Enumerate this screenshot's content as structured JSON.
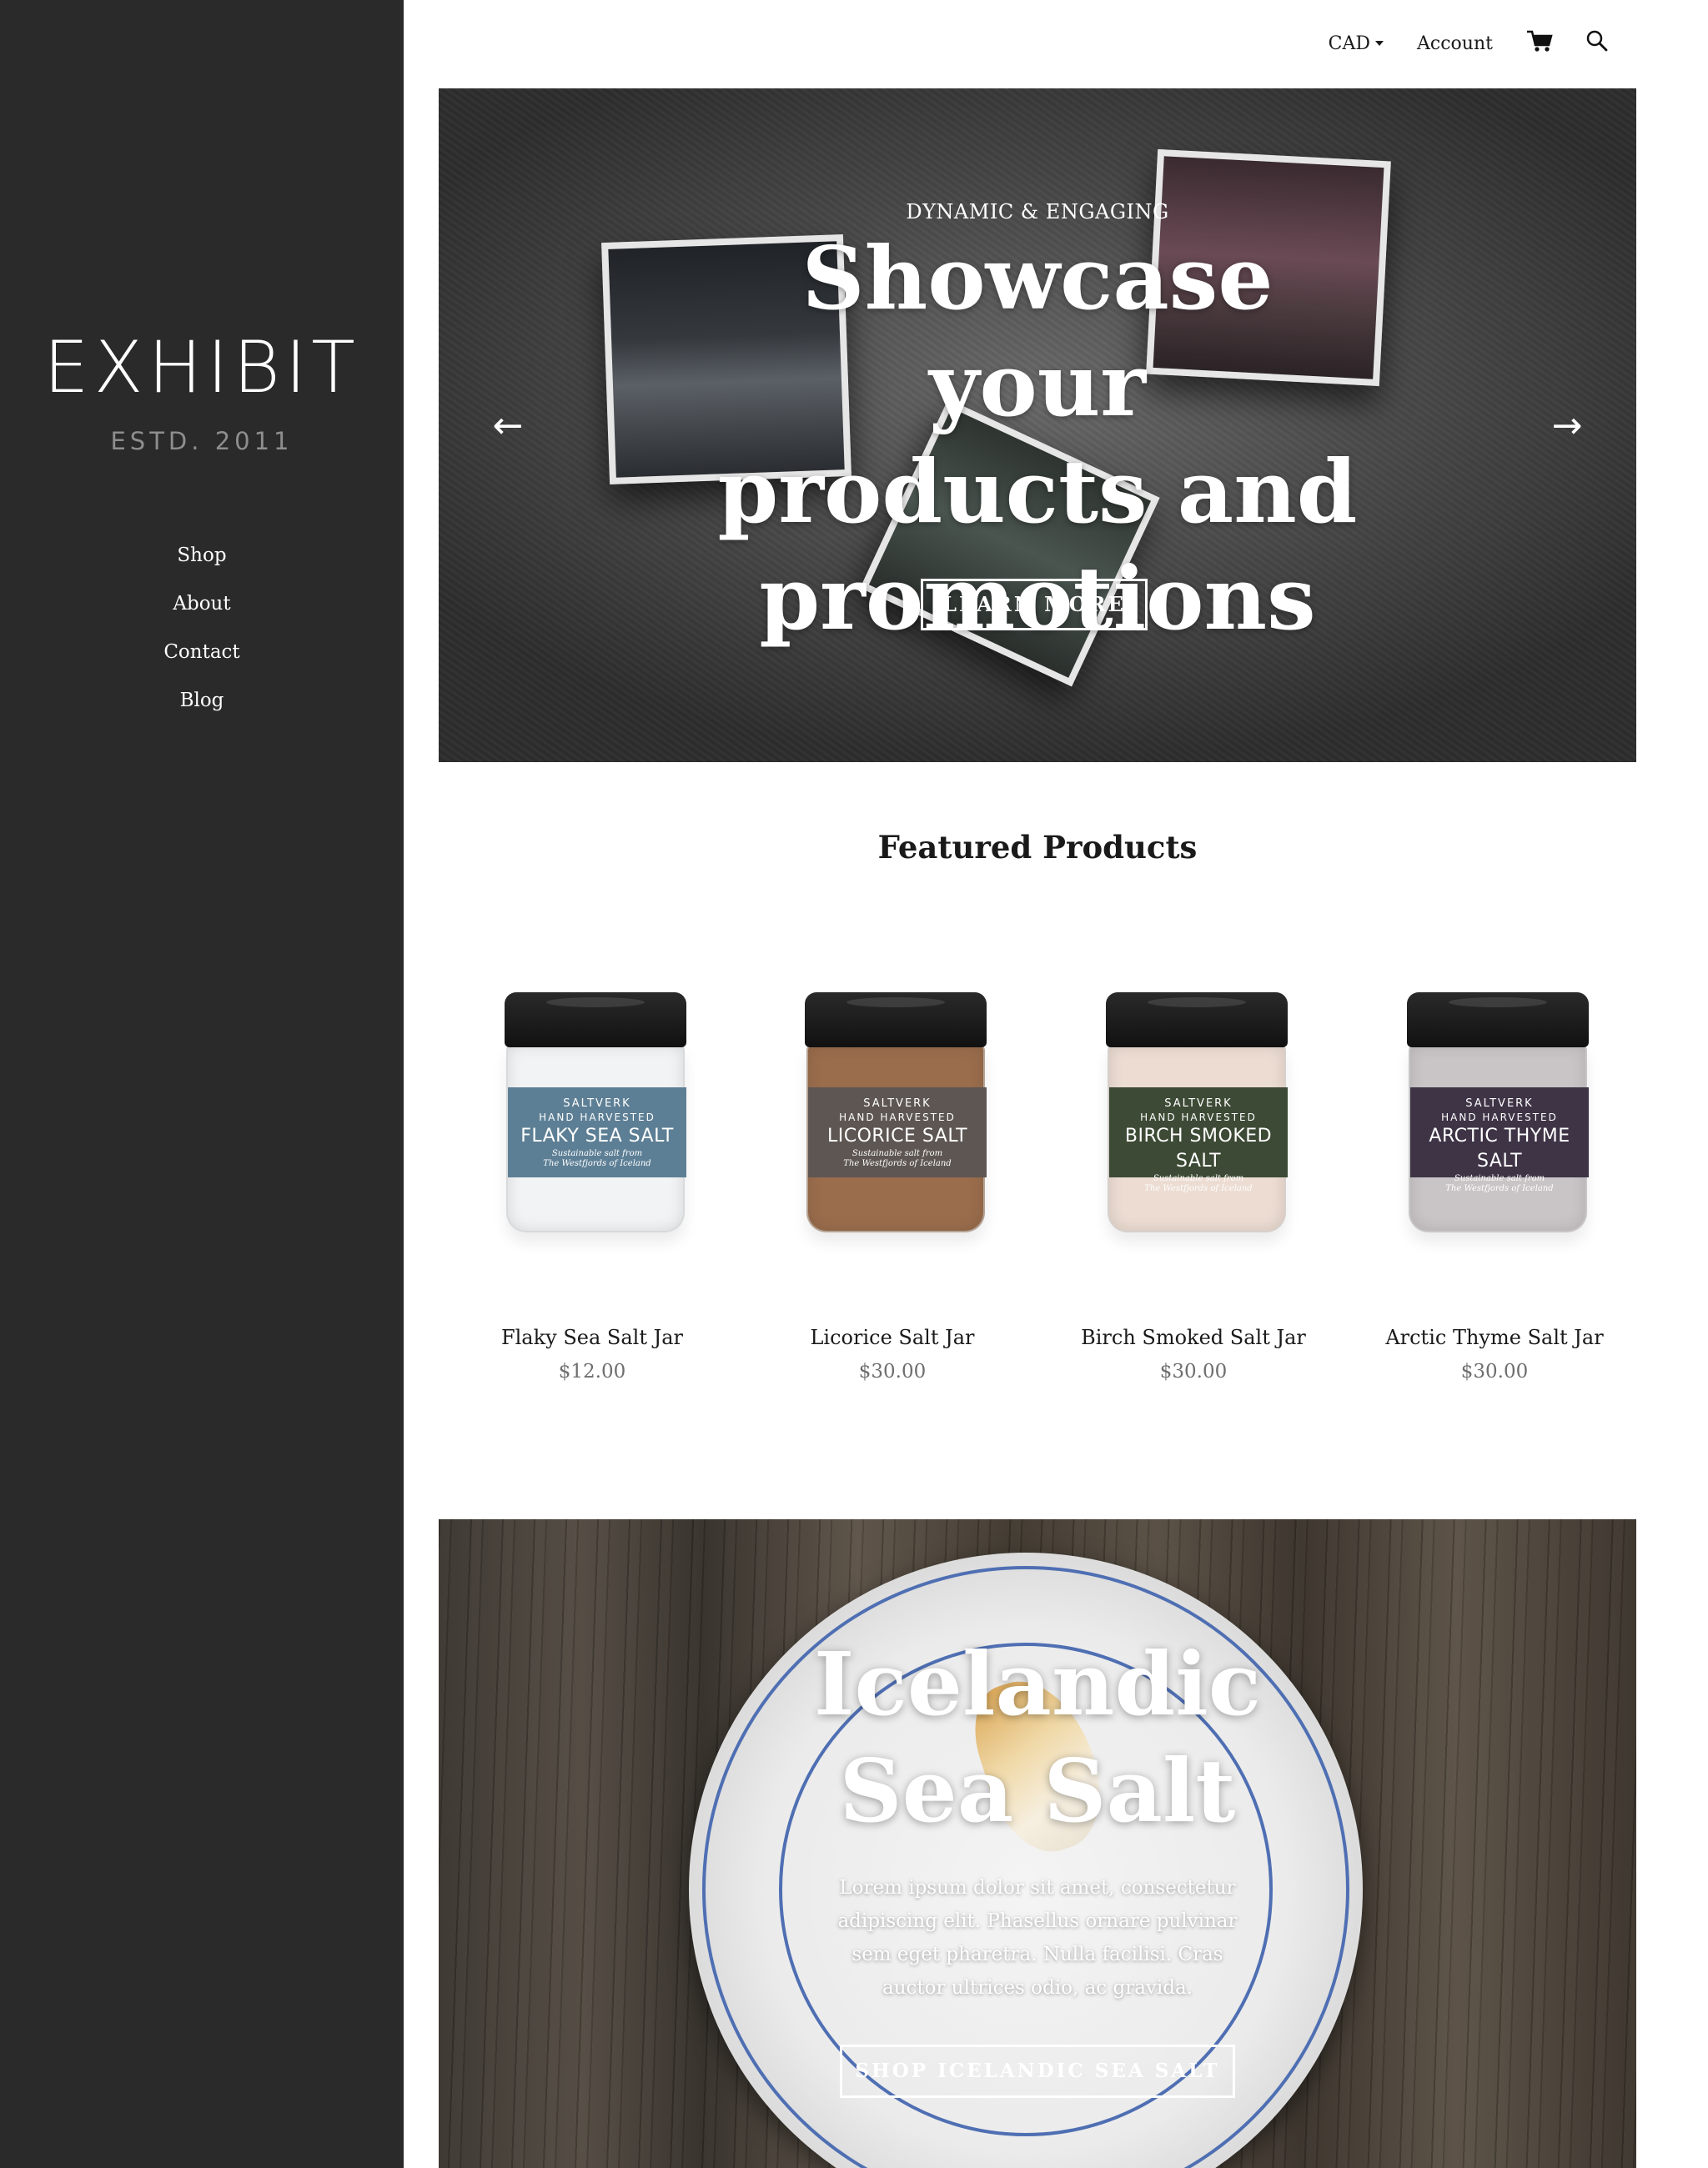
{
  "sidebar": {
    "logo": "EXHIBIT",
    "estd": "ESTD. 2011",
    "nav": [
      {
        "label": "Shop"
      },
      {
        "label": "About"
      },
      {
        "label": "Contact"
      },
      {
        "label": "Blog"
      }
    ]
  },
  "topbar": {
    "currency": "CAD",
    "account": "Account",
    "cart_icon": "cart-icon",
    "search_icon": "search-icon"
  },
  "hero": {
    "eyebrow": "DYNAMIC & ENGAGING",
    "title": "Showcase your products and promotions",
    "button": "LEARN MORE",
    "prev_icon": "arrow-left-icon",
    "next_icon": "arrow-right-icon",
    "prev_glyph": "←",
    "next_glyph": "→"
  },
  "featured": {
    "title": "Featured Products",
    "products": [
      {
        "name": "Flaky Sea Salt Jar",
        "price": "$12.00",
        "label_brand": "SALTVERK",
        "label_hh": "HAND HARVESTED",
        "label_name": "FLAKY SEA SALT",
        "label_sub1": "Sustainable salt from",
        "label_sub2": "The Westfjords of Iceland",
        "label_color": "#5d7f95",
        "fill_color": "#f1f3f5"
      },
      {
        "name": "Licorice Salt Jar",
        "price": "$30.00",
        "label_brand": "SALTVERK",
        "label_hh": "HAND HARVESTED",
        "label_name": "LICORICE SALT",
        "label_sub1": "Sustainable salt from",
        "label_sub2": "The Westfjords of Iceland",
        "label_color": "#5d5652",
        "fill_color": "#9a6d4c"
      },
      {
        "name": "Birch Smoked Salt Jar",
        "price": "$30.00",
        "label_brand": "SALTVERK",
        "label_hh": "HAND HARVESTED",
        "label_name": "BIRCH SMOKED SALT",
        "label_sub1": "Sustainable salt from",
        "label_sub2": "The Westfjords of Iceland",
        "label_color": "#3d4a35",
        "fill_color": "#ecdcd2"
      },
      {
        "name": "Arctic Thyme Salt Jar",
        "price": "$30.00",
        "label_brand": "SALTVERK",
        "label_hh": "HAND HARVESTED",
        "label_name": "ARCTIC THYME SALT",
        "label_sub1": "Sustainable salt from",
        "label_sub2": "The Westfjords of Iceland",
        "label_color": "#3e3446",
        "fill_color": "#c9c4c6"
      }
    ]
  },
  "banner": {
    "title": "Icelandic Sea Salt",
    "text": "Lorem ipsum dolor sit amet, consectetur adipiscing elit. Phasellus ornare pulvinar sem eget pharetra. Nulla facilisi. Cras auctor ultrices odio, ac gravida.",
    "button": "SHOP ICELANDIC SEA SALT"
  }
}
